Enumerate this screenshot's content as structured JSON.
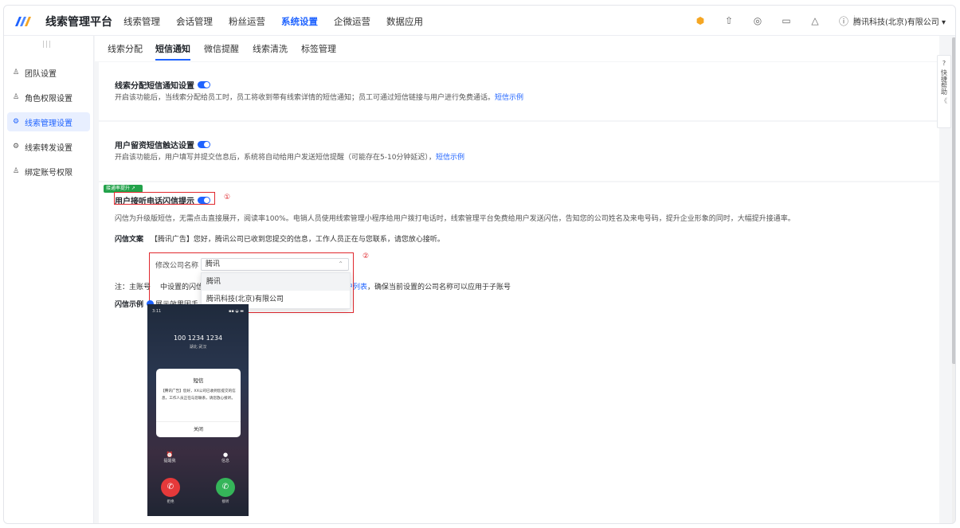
{
  "app": {
    "title": "线索管理平台"
  },
  "nav": {
    "items": [
      {
        "label": "线索管理",
        "active": false
      },
      {
        "label": "会话管理",
        "active": false
      },
      {
        "label": "粉丝运营",
        "active": false
      },
      {
        "label": "系统设置",
        "active": true
      },
      {
        "label": "企微运营",
        "active": false
      },
      {
        "label": "数据应用",
        "active": false
      }
    ],
    "icons": [
      "shield-icon",
      "upload-icon",
      "notification-badge-icon",
      "document-icon",
      "bell-icon",
      "help-icon"
    ],
    "company": "腾讯科技(北京)有限公司",
    "company_dropdown": "▾"
  },
  "sidebar": {
    "collapse_mark": "|||",
    "items": [
      {
        "label": "团队设置",
        "icon": "user-icon"
      },
      {
        "label": "角色权限设置",
        "icon": "role-icon"
      },
      {
        "label": "线索管理设置",
        "icon": "settings-icon",
        "active": true
      },
      {
        "label": "线索转发设置",
        "icon": "forward-icon"
      },
      {
        "label": "绑定账号权限",
        "icon": "account-icon"
      }
    ]
  },
  "subtabs": [
    {
      "label": "线索分配",
      "active": false
    },
    {
      "label": "短信通知",
      "active": true
    },
    {
      "label": "微信提醒",
      "active": false
    },
    {
      "label": "线索清洗",
      "active": false
    },
    {
      "label": "标签管理",
      "active": false
    }
  ],
  "card1": {
    "title": "线索分配短信通知设置",
    "desc": "开启该功能后，当线索分配给员工时，员工将收到带有线索详情的短信通知；员工可通过短信链接与用户进行免费通话。",
    "link": "短信示例"
  },
  "card2": {
    "title": "用户留资短信触达设置",
    "desc": "开启该功能后，用户填写并提交信息后，系统将自动给用户发送短信提醒（可能存在5-10分钟延迟），",
    "link": "短信示例"
  },
  "card3": {
    "badge": "接通率提升 ↗",
    "title": "用户接听电话闪信提示",
    "marker1": "①",
    "marker2": "②",
    "desc": "闪信为升级版短信，无需点击直接展开，阅读率100%。电销人员使用线索管理小程序给用户拨打电话时，线索管理平台免费给用户发送闪信，告知您的公司姓名及来电号码，提升企业形象的同时，大幅提升接通率。",
    "copy_label": "闪信文案",
    "copy_text": "【腾讯广告】您好，腾讯公司已收到您提交的信息，工作人员正在与您联系，请您放心接听。",
    "company_label": "修改公司名称",
    "company_value": "腾讯",
    "options": [
      "腾讯",
      "腾讯科技(北京)有限公司"
    ],
    "note_prefix": "注：主账号",
    "note_mid": "中设置的闪信",
    "note_link": "至子账户列表",
    "note_suffix": "，确保当前设置的公司名称可以应用于子账号",
    "example_label": "闪信示例",
    "example_hint": "展示效果因手"
  },
  "phone": {
    "time": "3:11",
    "signal": "▪▪ ◒ ▬",
    "number": "100 1234 1234",
    "location": "湖北 武汉",
    "sms_title": "短信",
    "sms_body": "【腾讯广告】您好，XX公司已收到您提交的信息，工作人员正在与您联系，请您放心接听。",
    "sms_close": "关闭",
    "remind": "提醒我",
    "message": "信息",
    "decline": "拒绝",
    "accept": "接听"
  },
  "help": {
    "icon": "question-icon",
    "label": "快捷帮助",
    "collapse": "《"
  }
}
